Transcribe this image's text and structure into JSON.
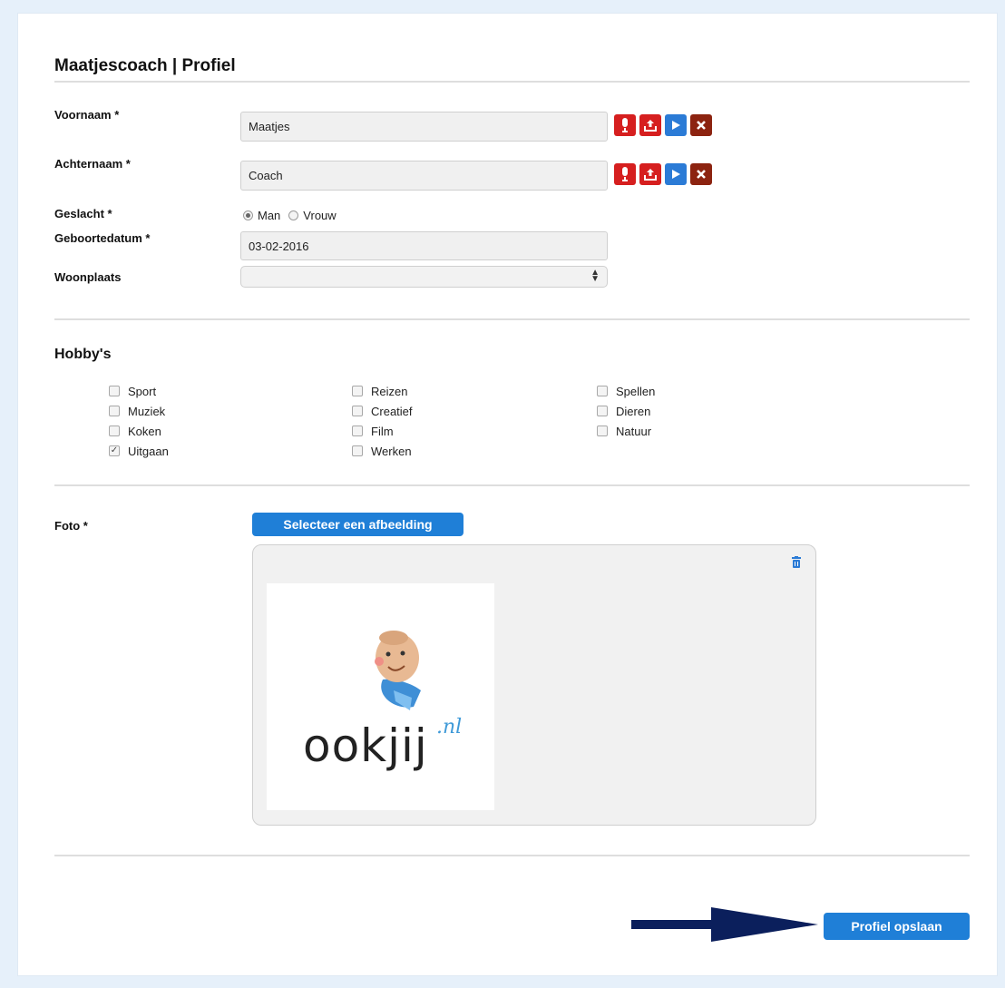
{
  "header": {
    "title": "Maatjescoach | Profiel"
  },
  "form": {
    "voornaam": {
      "label": "Voornaam *",
      "value": "Maatjes"
    },
    "achternaam": {
      "label": "Achternaam *",
      "value": "Coach"
    },
    "geslacht": {
      "label": "Geslacht *",
      "options": [
        "Man",
        "Vrouw"
      ],
      "selected": "Man"
    },
    "geboortedatum": {
      "label": "Geboortedatum *",
      "value": "03-02-2016"
    },
    "woonplaats": {
      "label": "Woonplaats",
      "value": ""
    }
  },
  "hobbies": {
    "title": "Hobby's",
    "items": [
      {
        "label": "Sport",
        "checked": false
      },
      {
        "label": "Muziek",
        "checked": false
      },
      {
        "label": "Koken",
        "checked": false
      },
      {
        "label": "Uitgaan",
        "checked": true
      },
      {
        "label": "Reizen",
        "checked": false
      },
      {
        "label": "Creatief",
        "checked": false
      },
      {
        "label": "Film",
        "checked": false
      },
      {
        "label": "Werken",
        "checked": false
      },
      {
        "label": "Spellen",
        "checked": false
      },
      {
        "label": "Dieren",
        "checked": false
      },
      {
        "label": "Natuur",
        "checked": false
      }
    ]
  },
  "photo": {
    "label": "Foto *",
    "select_button": "Selecteer een afbeelding",
    "logo_text": "ookjij",
    "logo_suffix": ".nl"
  },
  "save_button": "Profiel opslaan",
  "colors": {
    "primary_blue": "#1f7fd7",
    "icon_red": "#d61f1f",
    "icon_dark_red": "#8c2310",
    "arrow": "#0b1f5c",
    "page_bg": "#e6f0fa"
  },
  "icons": [
    "microphone-icon",
    "upload-icon",
    "play-icon",
    "close-icon",
    "select-arrows-icon",
    "trash-icon",
    "arrow-right-icon"
  ]
}
